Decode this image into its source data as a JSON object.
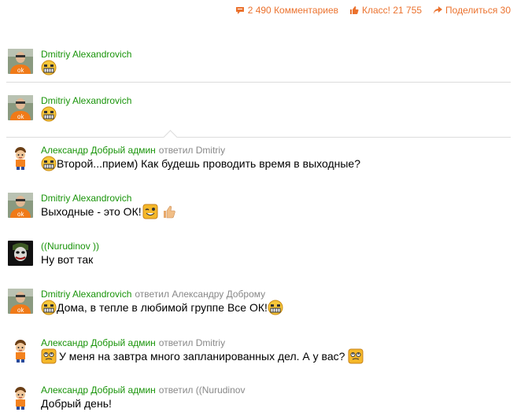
{
  "topbar": {
    "comments": "2 490 Комментариев",
    "klass": "Класс! 21 755",
    "share": "Поделиться 30"
  },
  "comments": [
    {
      "author": "Dmitriy Alexandrovich",
      "reply_prefix": "",
      "reply_to": "",
      "text": "",
      "avatar": "ok-shirt-man-avatar"
    },
    {
      "author": "Dmitriy Alexandrovich",
      "reply_prefix": "",
      "reply_to": "",
      "text": "",
      "avatar": "ok-shirt-man-avatar"
    },
    {
      "author": "Александр Добрый админ",
      "reply_prefix": "ответил",
      "reply_to": "Dmitriy",
      "text": "Второй...прием) Как будешь проводить время в выходные?",
      "avatar": "cartoon-boy-avatar"
    },
    {
      "author": "Dmitriy Alexandrovich",
      "reply_prefix": "",
      "reply_to": "",
      "text": "Выходные - это ОК!",
      "avatar": "ok-shirt-man-avatar"
    },
    {
      "author": "((Nurudinov ))",
      "reply_prefix": "",
      "reply_to": "",
      "text": "Ну вот так",
      "avatar": "joker-avatar"
    },
    {
      "author": "Dmitriy Alexandrovich",
      "reply_prefix": "ответил",
      "reply_to": "Александру Доброму",
      "text": "Дома, в тепле в любимой группе Все ОК!",
      "avatar": "ok-shirt-man-avatar"
    },
    {
      "author": "Александр Добрый админ",
      "reply_prefix": "ответил",
      "reply_to": "Dmitriy",
      "text": "У меня на завтра много запланированных дел. А у вас?",
      "avatar": "cartoon-boy-avatar"
    },
    {
      "author": "Александр Добрый админ",
      "reply_prefix": "ответил",
      "reply_to": "((Nurudinov",
      "text": "Добрый день!",
      "avatar": "cartoon-boy-avatar"
    }
  ],
  "colors": {
    "accent": "#eb722e",
    "author": "#19940a",
    "muted": "#888888",
    "separator": "#dcdcdc"
  }
}
